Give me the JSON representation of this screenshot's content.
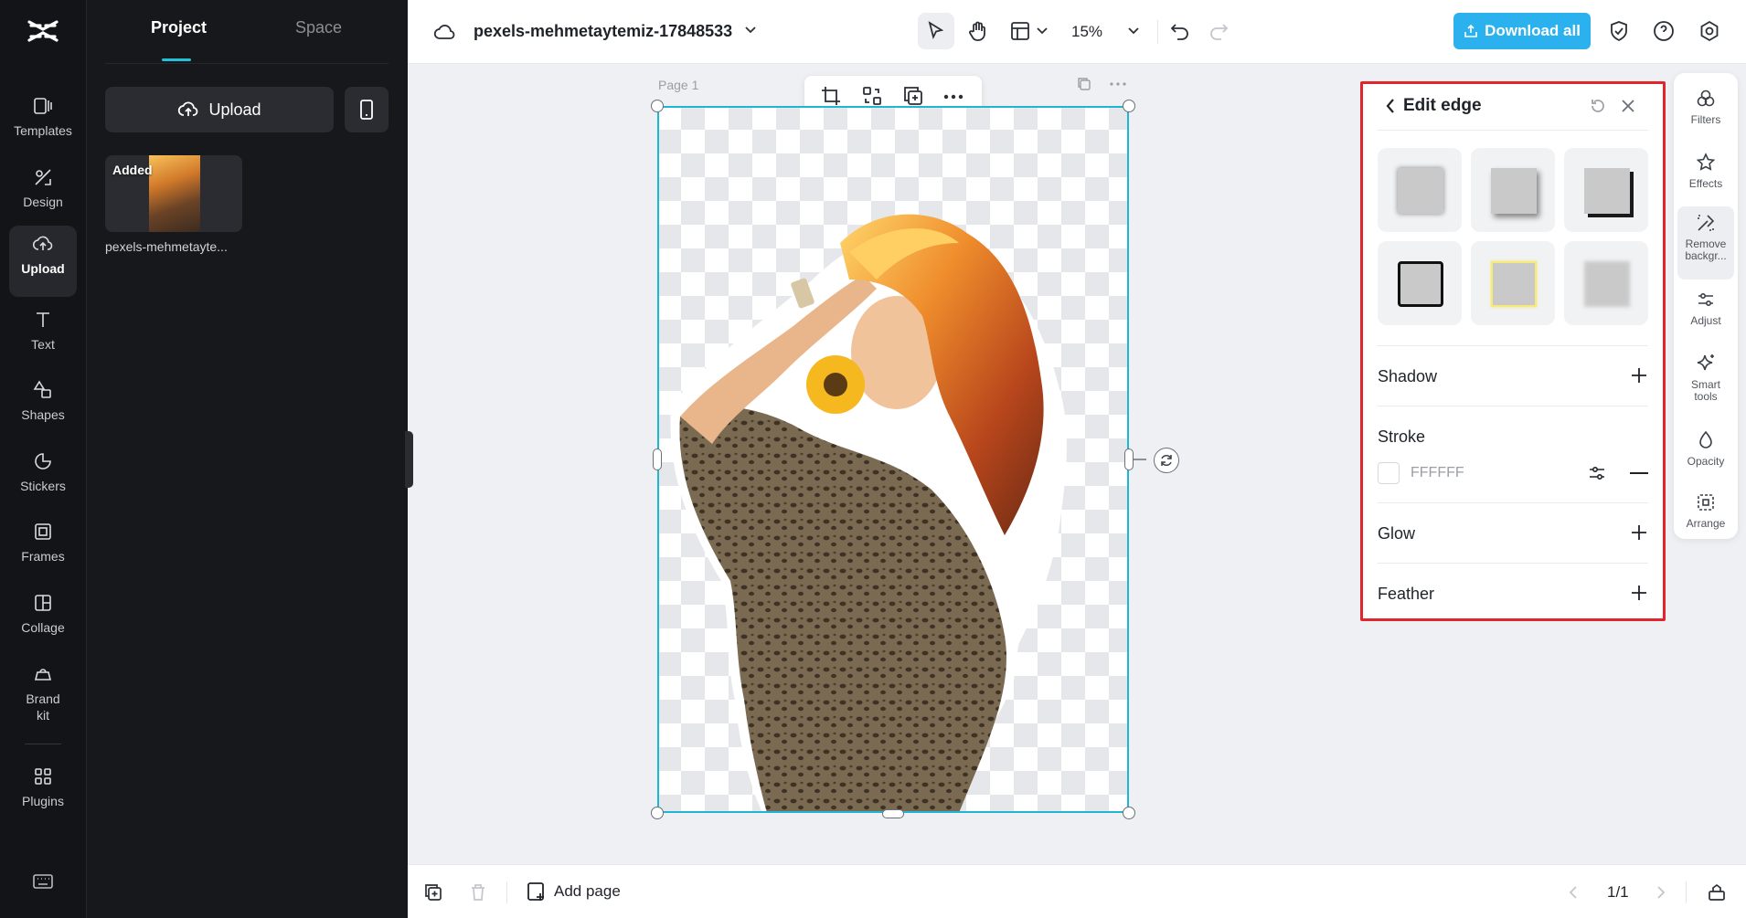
{
  "rail": {
    "items": [
      {
        "label": "Templates",
        "icon": "templates-icon"
      },
      {
        "label": "Design",
        "icon": "design-icon"
      },
      {
        "label": "Upload",
        "icon": "upload-cloud-icon",
        "active": true
      },
      {
        "label": "Text",
        "icon": "text-icon"
      },
      {
        "label": "Shapes",
        "icon": "shapes-icon"
      },
      {
        "label": "Stickers",
        "icon": "stickers-icon"
      },
      {
        "label": "Frames",
        "icon": "frames-icon"
      },
      {
        "label": "Collage",
        "icon": "collage-icon"
      },
      {
        "label": "Brand kit",
        "icon": "brand-kit-icon"
      },
      {
        "label": "Plugins",
        "icon": "plugins-icon"
      }
    ]
  },
  "panel": {
    "tabs": [
      "Project",
      "Space"
    ],
    "active_tab": "Project",
    "upload_label": "Upload",
    "media": {
      "badge": "Added",
      "filename": "pexels-mehmetayte..."
    }
  },
  "topbar": {
    "project_name": "pexels-mehmetaytemiz-17848533",
    "zoom": "15%",
    "download_label": "Download all",
    "accent": "#2bb1ee"
  },
  "canvas": {
    "page_label": "Page 1",
    "selection_color": "#1fb6d3"
  },
  "edit_edge": {
    "title": "Edit edge",
    "sections": {
      "shadow": "Shadow",
      "stroke": "Stroke",
      "stroke_color": "FFFFFF",
      "glow": "Glow",
      "feather": "Feather"
    },
    "border_color": "#e0262c"
  },
  "right_tools": [
    {
      "label": "Filters",
      "icon": "filters-icon"
    },
    {
      "label": "Effects",
      "icon": "effects-icon"
    },
    {
      "label": "Remove backgr...",
      "icon": "remove-background-icon",
      "active": true
    },
    {
      "label": "Adjust",
      "icon": "adjust-icon"
    },
    {
      "label": "Smart tools",
      "icon": "smart-tools-icon"
    },
    {
      "label": "Opacity",
      "icon": "opacity-icon"
    },
    {
      "label": "Arrange",
      "icon": "arrange-icon"
    }
  ],
  "bottombar": {
    "add_page_label": "Add page",
    "page_counter": "1/1"
  }
}
